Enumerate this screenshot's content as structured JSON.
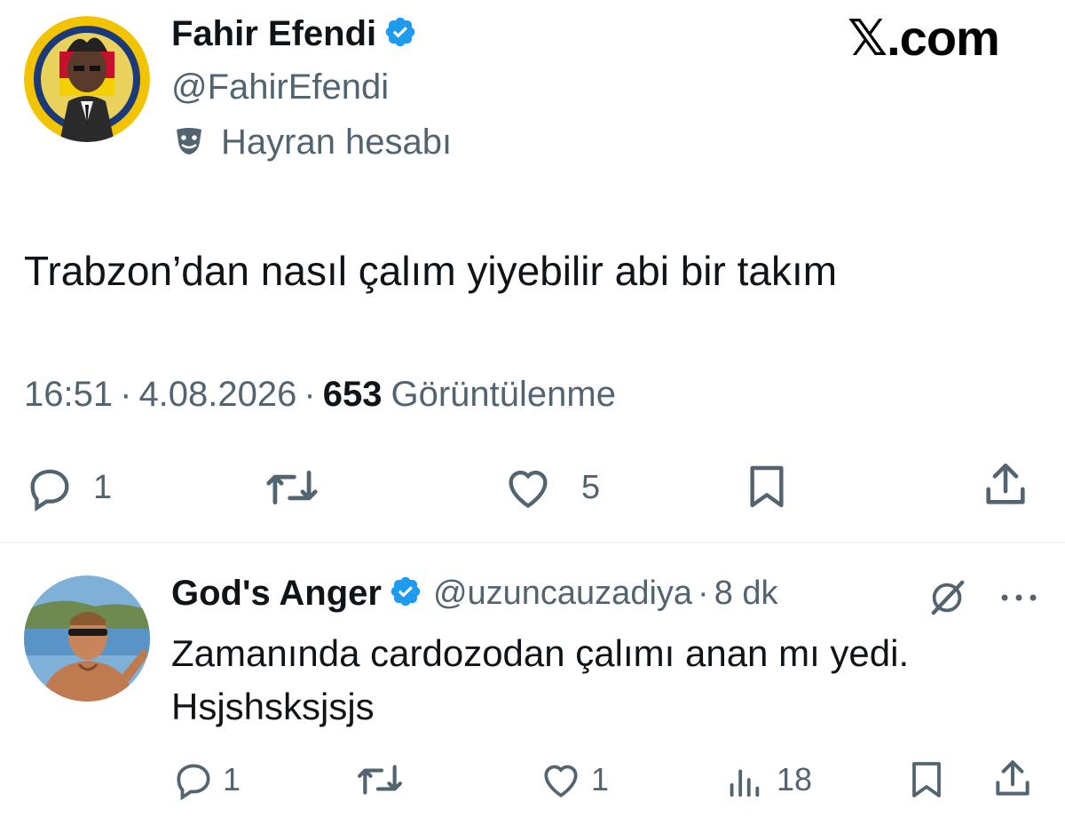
{
  "watermark": {
    "text": "X.com",
    "x_glyph": "𝕏",
    "rest": ".com"
  },
  "main_tweet": {
    "author_name": "Fahir Efendi",
    "handle": "@FahirEfendi",
    "label_icon": "theater-masks-icon",
    "label": "Hayran hesabı",
    "text": "Trabzon’dan nasıl çalım yiyebilir abi bir takım",
    "time": "16:51",
    "date": "4.08.2026",
    "sep": "·",
    "views": "653",
    "views_label": "Görüntülenme",
    "reply_count": "1",
    "like_count": "5"
  },
  "reply_tweet": {
    "author_name": "God's Anger",
    "handle": "@uzuncauzadiya",
    "sep": "·",
    "age": "8 dk",
    "text_line1": "Zamanında cardozodan çalımı anan mı yedi.",
    "text_line2": "Hsjshsksjsjs",
    "reply_count": "1",
    "like_count": "1",
    "views": "18"
  },
  "colors": {
    "verified": "#1d9bf0",
    "text": "#0f1419",
    "muted": "#536471",
    "divider": "#eff3f4"
  }
}
